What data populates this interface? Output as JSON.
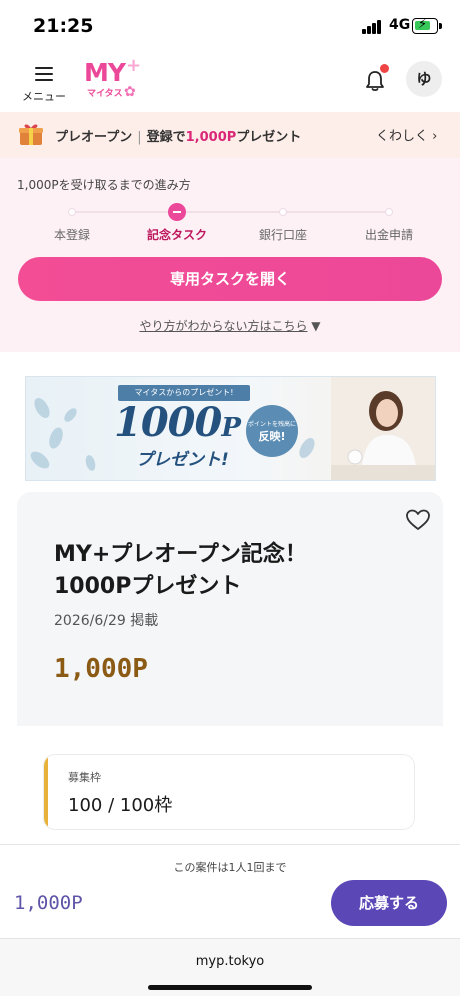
{
  "status_bar": {
    "time": "21:25",
    "network": "4G"
  },
  "header": {
    "menu_label": "メニュー",
    "logo": {
      "main": "MY",
      "plus": "+",
      "sub": "マイタス"
    },
    "avatar_initial": "ゆ"
  },
  "promo_banner": {
    "prefix": "プレオープン",
    "main": "登録で",
    "highlight": "1,000P",
    "suffix": "プレゼント",
    "link": "くわしく ›"
  },
  "progress": {
    "title": "1,000Pを受け取るまでの進み方",
    "steps": [
      {
        "label": "本登録",
        "active": false
      },
      {
        "label": "記念タスク",
        "active": true
      },
      {
        "label": "銀行口座",
        "active": false
      },
      {
        "label": "出金申請",
        "active": false
      }
    ],
    "button": "専用タスクを開く",
    "help_link": "やり方がわからない方はこちら",
    "help_arrow": "▼"
  },
  "campaign_image": {
    "ribbon": "マイタスからのプレゼント!",
    "amount": "1000",
    "unit": "P",
    "present": "プレゼント!",
    "badge_small": "ポイントを残高に",
    "badge_big": "反映!"
  },
  "detail": {
    "title_line1": "MY+プレオープン記念！",
    "title_line2": "1000Pプレゼント",
    "date": "2026/6/29 掲載",
    "points": "1,000P"
  },
  "quota": {
    "label": "募集枠",
    "value": "100 / 100枠"
  },
  "footer": {
    "note": "この案件は1人1回まで",
    "points": "1,000P",
    "apply": "応募する"
  },
  "browser": {
    "url": "myp.tokyo"
  },
  "colors": {
    "brand_pink": "#ec4899",
    "apply_purple": "#5b47b6",
    "points_brown": "#8b5a14",
    "quota_accent": "#e8b13a"
  },
  "icons": [
    "hamburger-icon",
    "bell-icon",
    "gift-icon",
    "heart-icon",
    "battery-icon",
    "signal-icon"
  ]
}
